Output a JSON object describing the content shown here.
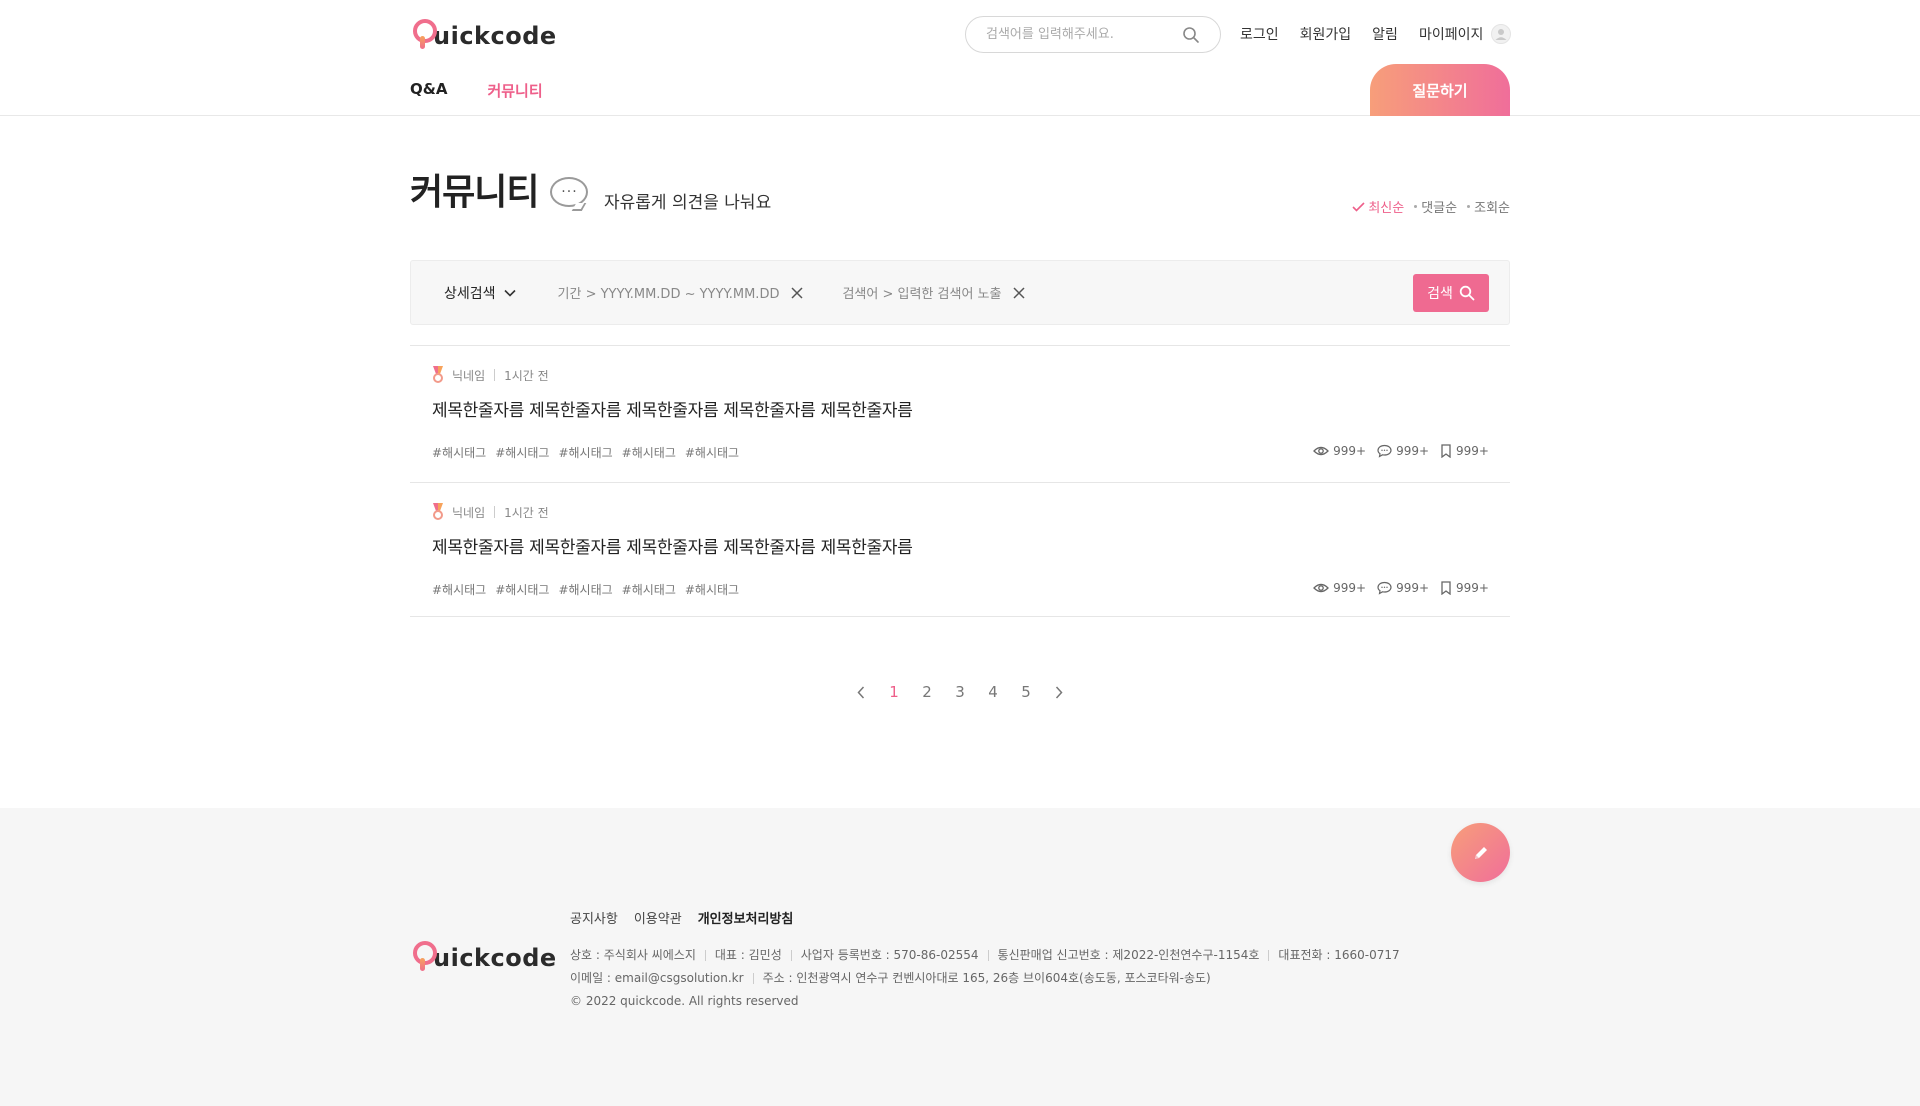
{
  "header": {
    "logo_text": "uickcode",
    "search_placeholder": "검색어를 입력해주세요.",
    "links": {
      "login": "로그인",
      "signup": "회원가입",
      "alarm": "알림",
      "mypage": "마이페이지"
    },
    "tabs": [
      {
        "label": "Q&A"
      },
      {
        "label": "커뮤니티"
      }
    ],
    "ask_button": "질문하기"
  },
  "page": {
    "title": "커뮤니티",
    "bubble": "···",
    "subtitle": "자유롭게 의견을 나눠요",
    "sort": [
      {
        "label": "최신순",
        "active": true
      },
      {
        "label": "댓글순"
      },
      {
        "label": "조회순"
      }
    ]
  },
  "filter": {
    "detail_label": "상세검색",
    "period_chip": "기간 > YYYY.MM.DD ~ YYYY.MM.DD",
    "keyword_chip": "검색어 > 입력한 검색어 노출",
    "search_button": "검색"
  },
  "posts": [
    {
      "nickname": "닉네임",
      "time": "1시간 전",
      "title": "제목한줄자름 제목한줄자름 제목한줄자름 제목한줄자름 제목한줄자름",
      "tags": [
        "#해시태그",
        "#해시태그",
        "#해시태그",
        "#해시태그",
        "#해시태그"
      ],
      "views": "999+",
      "comments": "999+",
      "bookmarks": "999+"
    },
    {
      "nickname": "닉네임",
      "time": "1시간 전",
      "title": "제목한줄자름 제목한줄자름 제목한줄자름 제목한줄자름 제목한줄자름",
      "tags": [
        "#해시태그",
        "#해시태그",
        "#해시태그",
        "#해시태그",
        "#해시태그"
      ],
      "views": "999+",
      "comments": "999+",
      "bookmarks": "999+"
    }
  ],
  "pagination": {
    "pages": [
      "1",
      "2",
      "3",
      "4",
      "5"
    ],
    "current": "1"
  },
  "footer": {
    "logo_text": "uickcode",
    "links": [
      "공지사항",
      "이용약관",
      "개인정보처리방침"
    ],
    "company": "상호 : 주식회사 씨에스지",
    "ceo": "대표 : 김민성",
    "business_no": "사업자 등록번호 : 570-86-02554",
    "ecommerce_no": "통신판매업 신고번호 : 제2022-인천연수구-1154호",
    "phone": "대표전화 : 1660-0717",
    "email": "이메일 : email@csgsolution.kr",
    "address": "주소 : 인천광역시 연수구 컨벤시아대로 165, 26층 브이604호(송도동, 포스코타워-송도)",
    "copyright": "© 2022 quickcode. All rights reserved"
  },
  "colors": {
    "accent": "#ee5f8a",
    "gradient_start": "#f79e7a",
    "gradient_end": "#f06e9a"
  },
  "icons": [
    "search-icon",
    "user-icon",
    "chevron-down-icon",
    "close-icon",
    "eye-icon",
    "comment-icon",
    "bookmark-icon",
    "pencil-icon",
    "chevron-left-icon",
    "chevron-right-icon",
    "check-icon",
    "medal-icon",
    "speech-bubble-icon"
  ]
}
